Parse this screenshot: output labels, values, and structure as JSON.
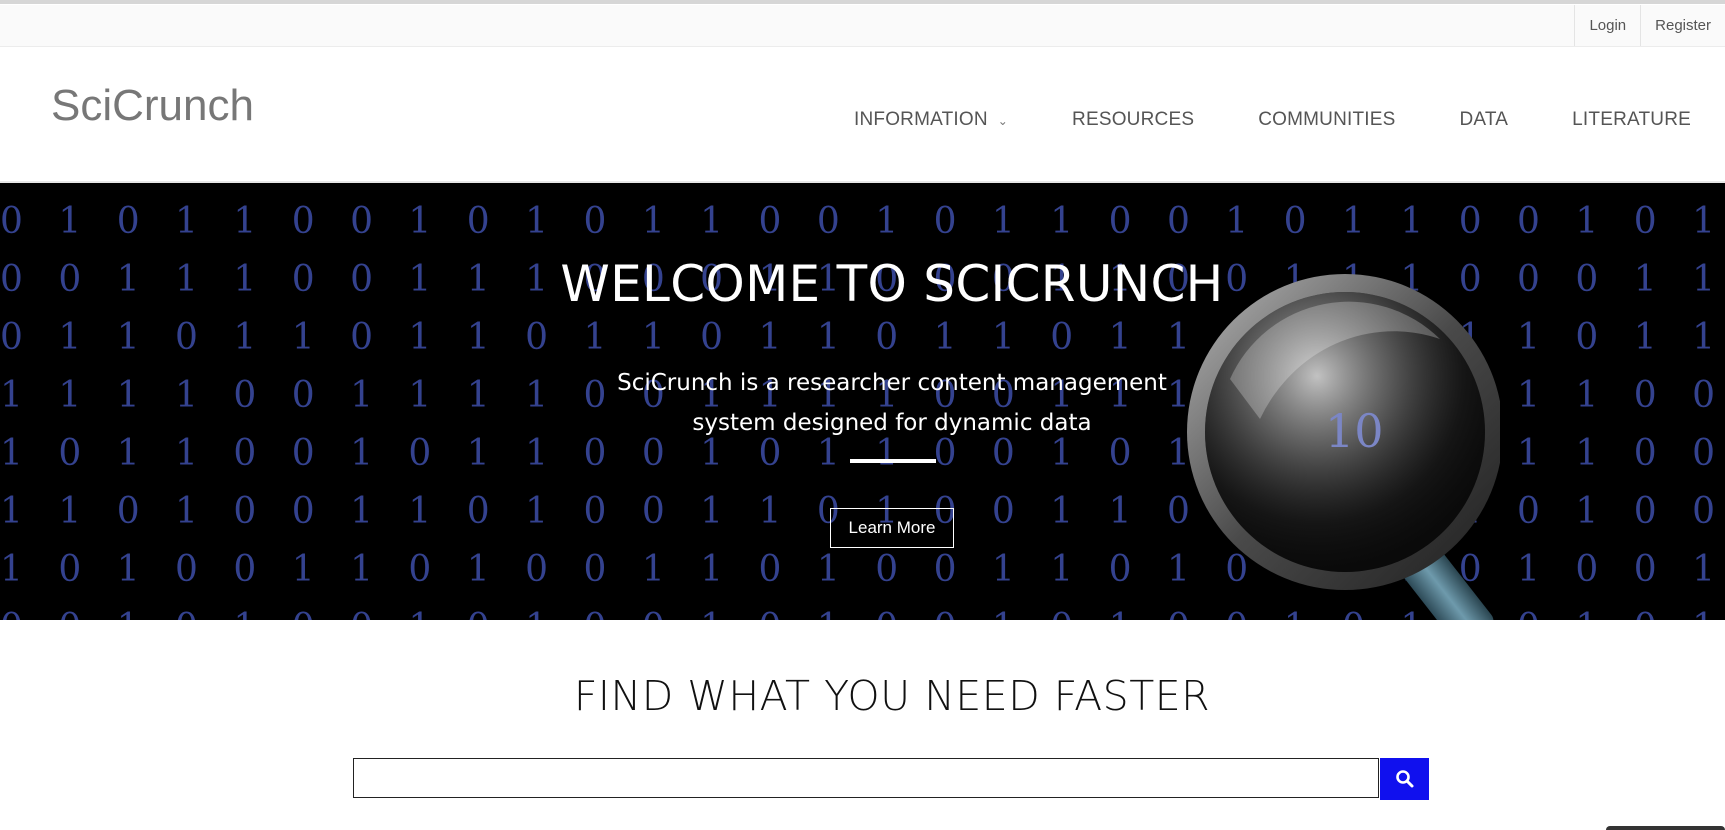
{
  "topbar": {
    "links": [
      "Login",
      "Register"
    ]
  },
  "header": {
    "logo": "SciCrunch",
    "nav": [
      {
        "label": "INFORMATION",
        "has_dropdown": true
      },
      {
        "label": "RESOURCES"
      },
      {
        "label": "COMMUNITIES"
      },
      {
        "label": "DATA"
      },
      {
        "label": "LITERATURE"
      }
    ]
  },
  "hero": {
    "title": "WELCOME TO SCICRUNCH",
    "subtitle_line1": "SciCrunch is a researcher content management",
    "subtitle_line2": "system designed for dynamic data",
    "button_label": "Learn More",
    "background_digits_color": "#34428f",
    "lens_label": "10"
  },
  "search": {
    "heading": "FIND WHAT YOU NEED FASTER",
    "placeholder": "",
    "button_icon": "search-icon",
    "button_color": "#1010ee"
  }
}
